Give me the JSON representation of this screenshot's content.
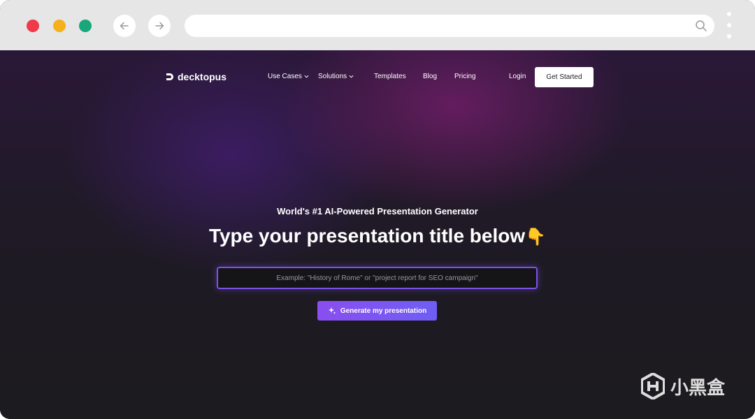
{
  "browser": {
    "url": "",
    "colors": {
      "close": "#ef3a49",
      "minimize": "#f5b01d",
      "maximize": "#17a77a"
    }
  },
  "nav": {
    "brand": "decktopus",
    "links": [
      {
        "label": "Use Cases",
        "has_dropdown": true
      },
      {
        "label": "Solutions",
        "has_dropdown": true
      },
      {
        "label": "Templates"
      },
      {
        "label": "Blog"
      },
      {
        "label": "Pricing"
      }
    ],
    "login": "Login",
    "cta": "Get Started"
  },
  "hero": {
    "subtitle": "World's #1 AI-Powered Presentation Generator",
    "title": "Type your presentation title below",
    "hand_emoji": "👇",
    "input_placeholder": "Example: \"History of Rome\" or \"project report for SEO campaign\"",
    "button_label": "Generate my presentation",
    "accent": "#7b52e8"
  },
  "watermark": {
    "text": "小黑盒"
  }
}
